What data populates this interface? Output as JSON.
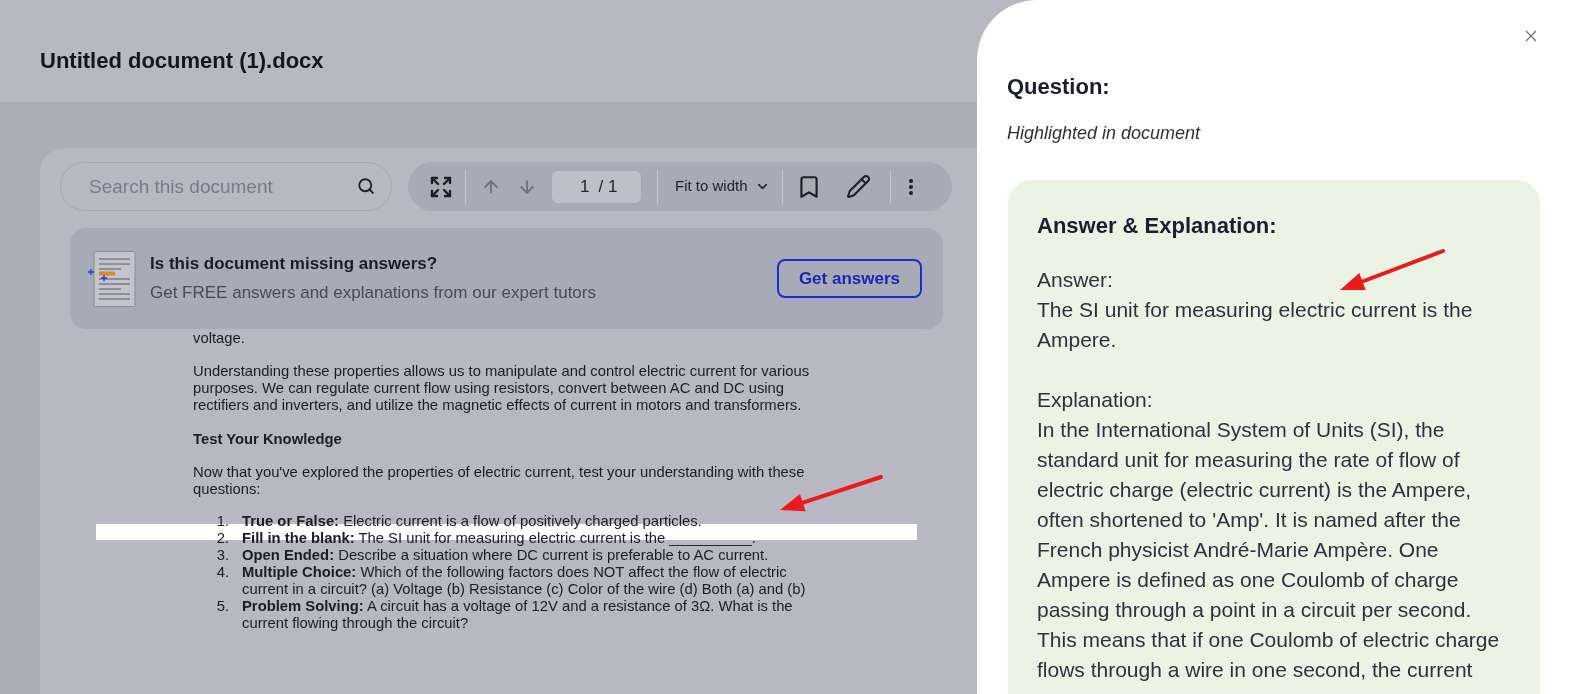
{
  "header": {
    "title": "Untitled document (1).docx"
  },
  "viewer": {
    "search": {
      "placeholder": "Search this document"
    },
    "toolbar": {
      "page_up": {
        "disabled": true
      },
      "page_down": {
        "disabled": true
      },
      "page_current": "1",
      "page_total": "/ 1",
      "zoom": "Fit to width"
    },
    "banner": {
      "title": "Is this document missing answers?",
      "text": "Get FREE answers and explanations from our expert tutors",
      "button": "Get answers"
    },
    "document": {
      "paragraphs": [
        "voltage.",
        "Understanding these properties allows us to manipulate and control electric current for various purposes. We can regulate current flow using resistors, convert between AC and DC using rectifiers and inverters, and utilize the magnetic effects of current in motors and transformers."
      ],
      "heading": "Test Your Knowledge",
      "intro": "Now that you've explored the properties of electric current, test your understanding with these questions:",
      "questions": [
        {
          "number": "1.",
          "text": "**True or False:** Electric current is a flow of positively charged particles.",
          "highlighted": false
        },
        {
          "number": "2.",
          "text": "**Fill in the blank:** The SI unit for measuring electric current is the __________.",
          "highlighted": true
        },
        {
          "number": "3.",
          "text": "**Open Ended:** Describe a situation where DC current is preferable to AC current.",
          "highlighted": false
        },
        {
          "number": "4.",
          "text": "**Multiple Choice:** Which of the following factors does NOT affect the flow of electric current in a circuit? (a) Voltage (b) Resistance (c) Color of the wire (d) Both (a) and (b)",
          "highlighted": false
        },
        {
          "number": "5.",
          "text": "**Problem Solving:** A circuit has a voltage of 12V and a resistance of 3Ω. What is the current flowing through the circuit?",
          "highlighted": false
        }
      ]
    }
  },
  "panel": {
    "question_heading": "Question:",
    "question_note": "Highlighted in document",
    "answer_card": {
      "heading": "Answer & Explanation:",
      "answer_label": "Answer:",
      "answer": "The SI unit for measuring electric current is the Ampere.",
      "explanation_label": "Explanation:",
      "explanation": "In the International System of Units (SI), the standard unit for measuring the rate of flow of electric charge (electric current) is the Ampere, often shortened to 'Amp'. It is named after the French physicist André-Marie Ampère. One Ampere is defined as one Coulomb of charge passing through a point in a circuit per second. This means that if one Coulomb of electric charge flows through a wire in one second, the current"
    }
  }
}
